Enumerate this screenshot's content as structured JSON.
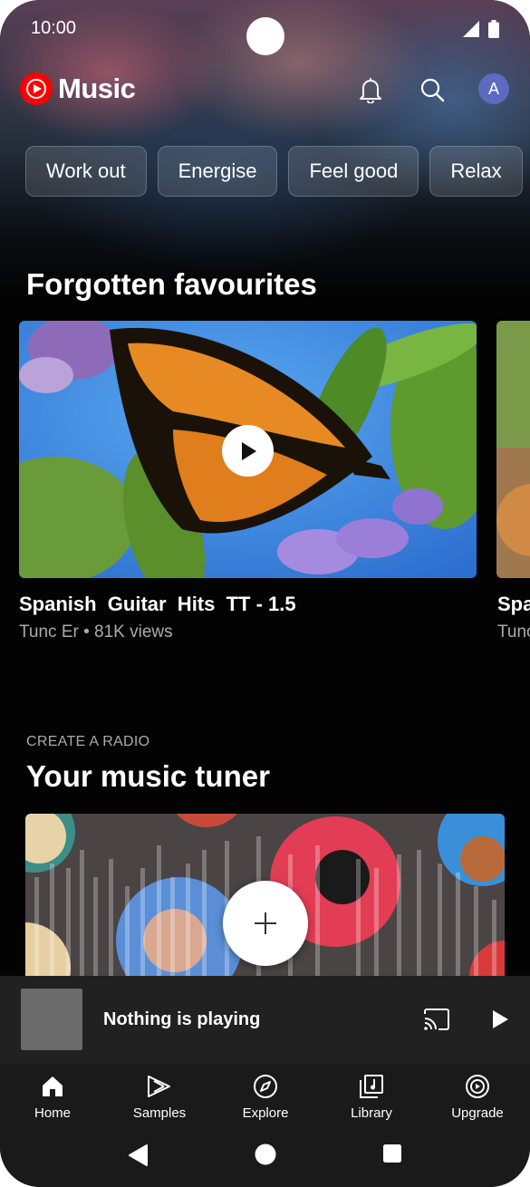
{
  "status_bar": {
    "time": "10:00",
    "icons": [
      "signal-icon",
      "battery-icon"
    ]
  },
  "header": {
    "logo_text": "Music",
    "icons": [
      "bell-icon",
      "search-icon"
    ],
    "avatar_letter": "A",
    "avatar_color": "#5c6bc0"
  },
  "chips": [
    "Work out",
    "Energise",
    "Feel good",
    "Relax"
  ],
  "forgotten": {
    "title": "Forgotten favourites",
    "cards": [
      {
        "title": "Spanish  Guitar  Hits  TT - 1.5",
        "subtitle": "Tunc Er • 81K views"
      },
      {
        "title": "Spa",
        "subtitle": "Tunc"
      }
    ]
  },
  "tuner": {
    "eyebrow": "CREATE A RADIO",
    "title": "Your music tuner"
  },
  "mini_player": {
    "title": "Nothing is playing",
    "icons": [
      "cast-icon",
      "play-icon"
    ]
  },
  "bottom_nav": [
    {
      "label": "Home",
      "icon": "home-icon"
    },
    {
      "label": "Samples",
      "icon": "samples-icon"
    },
    {
      "label": "Explore",
      "icon": "compass-icon"
    },
    {
      "label": "Library",
      "icon": "library-icon"
    },
    {
      "label": "Upgrade",
      "icon": "upgrade-icon"
    }
  ],
  "system_nav": [
    "back-icon",
    "home-circle-icon",
    "recents-icon"
  ],
  "colors": {
    "accent_red": "#ff0000",
    "background": "#030303",
    "mini_player": "#212121",
    "nav_bar": "#1a1a1a",
    "secondary_text": "#aaaaaa"
  }
}
